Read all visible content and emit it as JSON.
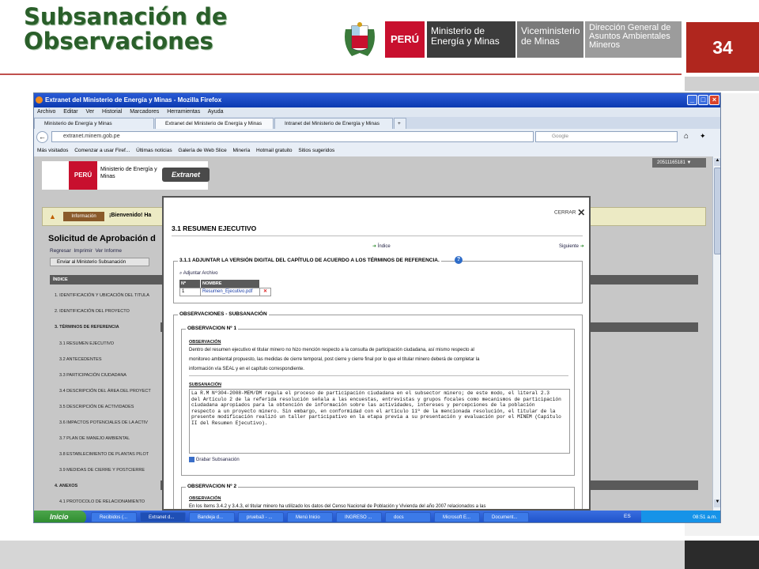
{
  "slide": {
    "title_line1": "Subsanación de",
    "title_line2": "Observaciones",
    "page_number": "34",
    "header_peru": "PERÚ",
    "header_ministry": "Ministerio de Energía y Minas",
    "header_vice": "Viceministerio de Minas",
    "header_dg": "Dirección General de Asuntos Ambientales Mineros"
  },
  "browser": {
    "window_title": "Extranet del Ministerio de Energía y Minas - Mozilla Firefox",
    "menu": [
      "Archivo",
      "Editar",
      "Ver",
      "Historial",
      "Marcadores",
      "Herramientas",
      "Ayuda"
    ],
    "tabs": [
      "Ministerio de Energía y Minas",
      "Extranet del Ministerio de Energía y Minas",
      "Intranet del Ministerio de Energía y Minas"
    ],
    "url": "extranet.minem.gob.pe",
    "search_placeholder": "Google",
    "bookmarks": [
      "Más visitados",
      "Comenzar a usar Firef...",
      "Últimas noticias",
      "Galería de Web Slice",
      "Minería",
      "Hotmail gratuito",
      "Sitios sugeridos"
    ]
  },
  "page": {
    "peru": "PERÚ",
    "ministry": "Ministerio de Energía y Minas",
    "extranet": "Extranet",
    "user_id": "20511165181",
    "info_label": "Información",
    "welcome": "¡Bienvenido! Ha",
    "heading": "Solicitud de Aprobación d",
    "actions": [
      "Regresar",
      "Imprimir",
      "Ver Informe"
    ],
    "send_button": "Enviar al Ministerio Subsanación",
    "index_header": "ÍNDICE",
    "index_items": [
      "1. IDENTIFICACIÓN Y UBICACIÓN DEL TITULA",
      "2. IDENTIFICACIÓN DEL PROYECTO",
      "3. TÉRMINOS DE REFERENCIA",
      "3.1 RESUMEN EJECUTIVO",
      "3.2 ANTECEDENTES",
      "3.3 PARTICIPACIÓN CIUDADANA",
      "3.4 DESCRIPCIÓN DEL ÁREA DEL PROYECT",
      "3.5 DESCRIPCIÓN DE ACTIVIDADES",
      "3.6 IMPACTOS POTENCIALES DE LA ACTIV",
      "3.7 PLAN DE MANEJO AMBIENTAL",
      "3.8 ESTABLECIMIENTO DE PLANTAS PILOT",
      "3.9 MEDIDAS DE CIERRE Y POSTCIERRE",
      "4. ANEXOS",
      "4.1 PROTOCOLO DE RELACIONAMIENTO"
    ]
  },
  "modal": {
    "close_label": "CERRAR",
    "title": "3.1 RESUMEN EJECUTIVO",
    "index_link": "Índice",
    "next_link": "Siguiente",
    "attach_title": "3.1.1 ADJUNTAR LA VERSIÓN DIGITAL DEL CAPÍTULO DE ACUERDO A LOS TÉRMINOS DE REFERENCIA.",
    "attach_link": "Adjuntar Archivo",
    "table_headers": [
      "Nº",
      "NOMBRE"
    ],
    "table_row": {
      "num": "1",
      "name": "Resumen_Ejecutivo.pdf"
    },
    "obs_section": "OBSERVACIONES - SUBSANACIÓN",
    "obs1_title": "OBSERVACION Nº 1",
    "observacion_label": "OBSERVACIÓN",
    "obs1_text": [
      "Dentro del resumen ejecutivo el titular minero no hizo mención respecto a la consulta de participación ciudadana, así mismo respecto al",
      "monitoreo ambiental propuesto, las medidas de cierre temporal, post cierre y cierre final por lo que el titular minero deberá de completar la",
      "información vía SEAL y en el capítulo correspondiente."
    ],
    "subsanacion_label": "SUBSANACIÓN",
    "sub1_text": "La R.M Nº304-2008-MEM/DM regula el proceso de participación ciudadana en el subsector minero; de este modo, el literal 2.3\ndel Artículo 2 de la referida resolución señala a las encuestas, entrevistas y grupos focales como mecanismos de participación\nciudadana apropiados para la obtención de información sobre las actividades, intereses y percepciones de la población\nrespecto a un proyecto minero. Sin embargo, en conformidad con el artículo 11º de la mencionada resolución, el titular de la\npresente modificación realizó un taller participativo en la etapa previa a su presentación y evaluación por el MINEM (Capítulo\nII del Resumen Ejecutivo).",
    "save_link": "Grabar Subsanación",
    "obs2_title": "OBSERVACION Nº 2",
    "obs2_text": "En los ítems 3.4.2 y 3.4.3, el titular minero ha utilizado los datos del Censo Nacional de Población y Vivienda del año 2007 relacionados a las"
  },
  "taskbar": {
    "start": "Inicio",
    "items": [
      "Recibidos (...",
      "Extranet d...",
      "Bandeja d...",
      "prueba3 - ...",
      "Menú Inicio",
      "INGRESO ...",
      "docs",
      "Microsoft E...",
      "Document..."
    ],
    "lang": "ES",
    "clock": "08:51 a.m."
  }
}
